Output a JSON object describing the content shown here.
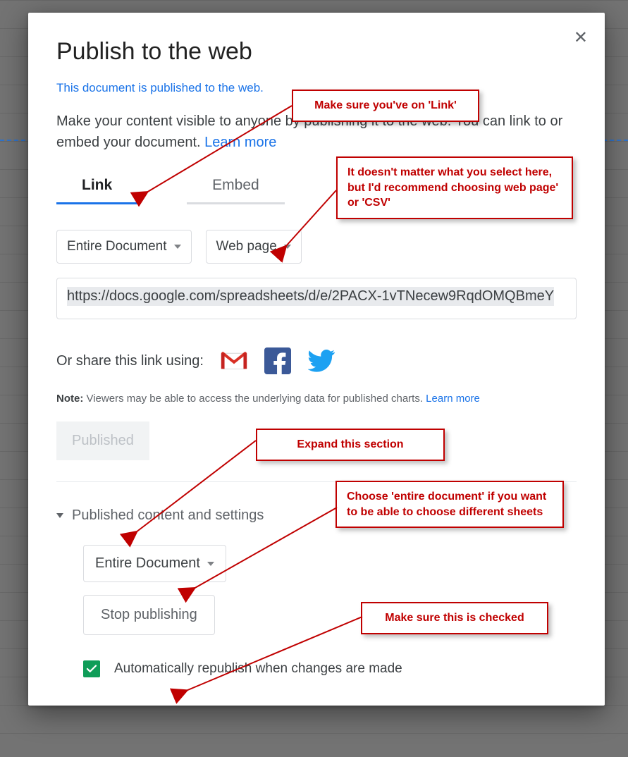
{
  "dialog": {
    "title": "Publish to the web",
    "published_line": "This document is published to the web.",
    "description_part1": "Make your content visible to anyone by publishing it to the web. You can link to or embed your document. ",
    "learn_more": "Learn more",
    "tabs": {
      "link": "Link",
      "embed": "Embed"
    },
    "scope_dropdown": "Entire Document",
    "format_dropdown": "Web page",
    "url": "https://docs.google.com/spreadsheets/d/e/2PACX-1vTNecew9RqdOMQBmeY",
    "share_label": "Or share this link using:",
    "note_prefix": "Note:",
    "note_text": " Viewers may be able to access the underlying data for published charts. ",
    "note_learn": "Learn more",
    "published_button": "Published",
    "expander_label": "Published content and settings",
    "sub_scope_dropdown": "Entire Document",
    "stop_button": "Stop publishing",
    "auto_republish": "Automatically republish when changes are made"
  },
  "annotations": {
    "a1": "Make sure you've on 'Link'",
    "a2": "It doesn't matter what you select here, but I'd recommend choosing web page' or 'CSV'",
    "a3": "Expand this section",
    "a4": "Choose 'entire document' if you want to be able to choose different sheets",
    "a5": "Make sure this is checked"
  }
}
